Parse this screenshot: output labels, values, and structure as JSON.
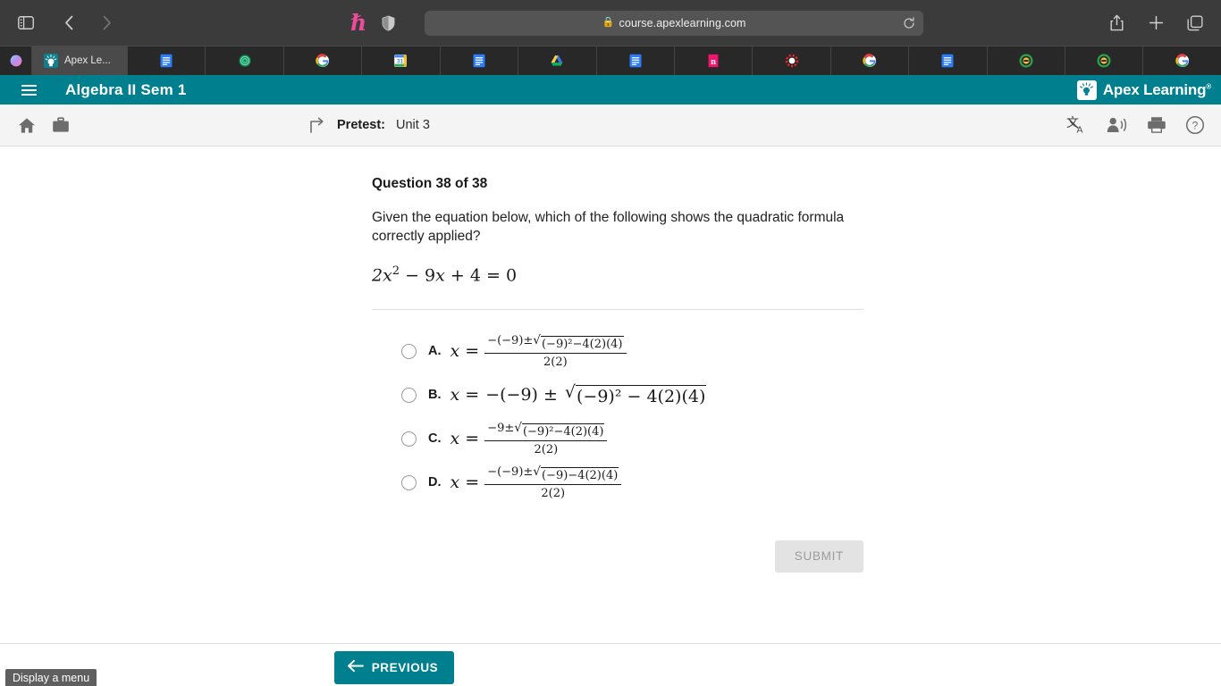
{
  "browser": {
    "url": "course.apexlearning.com",
    "lock_icon": "lock-icon",
    "sidebar_icon": "sidebar-toggle-icon",
    "back_icon": "back-chevron-icon",
    "forward_icon": "forward-chevron-icon",
    "honey_icon": "honey-extension-icon",
    "shield_icon": "shield-extension-icon",
    "reload_icon": "reload-icon",
    "share_icon": "share-icon",
    "newtab_icon": "plus-icon",
    "tabs_overview_icon": "tab-overview-icon",
    "active_tab_title": "Apex Le...",
    "tabs": [
      {
        "name": "tab-arc-browser",
        "favicon": "arc-icon",
        "title": ""
      },
      {
        "name": "tab-apex-learning",
        "favicon": "apex-icon",
        "title": "Apex Le..."
      },
      {
        "name": "tab-google-docs-1",
        "favicon": "docs-icon",
        "title": ""
      },
      {
        "name": "tab-green-globe",
        "favicon": "green-orb-icon",
        "title": ""
      },
      {
        "name": "tab-google-1",
        "favicon": "google-icon",
        "title": ""
      },
      {
        "name": "tab-google-calendar",
        "favicon": "calendar-31-icon",
        "title": ""
      },
      {
        "name": "tab-google-docs-2",
        "favicon": "docs-icon",
        "title": ""
      },
      {
        "name": "tab-google-drive",
        "favicon": "drive-icon",
        "title": ""
      },
      {
        "name": "tab-google-docs-3",
        "favicon": "docs-icon",
        "title": ""
      },
      {
        "name": "tab-notion",
        "favicon": "notion-n-icon",
        "title": ""
      },
      {
        "name": "tab-red-dotted",
        "favicon": "red-circle-icon",
        "title": ""
      },
      {
        "name": "tab-google-2",
        "favicon": "google-icon",
        "title": ""
      },
      {
        "name": "tab-google-docs-4",
        "favicon": "docs-icon",
        "title": ""
      },
      {
        "name": "tab-green-ring-1",
        "favicon": "green-ring-icon",
        "title": ""
      },
      {
        "name": "tab-green-ring-2",
        "favicon": "green-ring-icon",
        "title": ""
      },
      {
        "name": "tab-google-3",
        "favicon": "google-icon",
        "title": ""
      }
    ]
  },
  "app_header": {
    "menu_icon": "hamburger-menu-icon",
    "course_title": "Algebra II Sem 1",
    "brand_name": "Apex Learning",
    "brand_tm": "®",
    "brand_logo_icon": "apex-sun-logo-icon",
    "accent_color": "#00808f"
  },
  "subbar": {
    "home_icon": "home-icon",
    "briefcase_icon": "briefcase-icon",
    "up_level_icon": "up-level-arrow-icon",
    "breadcrumb_label": "Pretest:",
    "breadcrumb_value": "Unit 3",
    "translate_icon": "translate-icon",
    "read_aloud_icon": "read-aloud-icon",
    "print_icon": "print-icon",
    "help_icon": "help-icon"
  },
  "question": {
    "number_label": "Question 38 of 38",
    "prompt": "Given the equation below, which of the following shows the quadratic formula correctly applied?",
    "equation": {
      "coef_a": "2",
      "var": "x",
      "exp": "2",
      "minus": "−",
      "coef_b": "9",
      "plus": "+",
      "coef_c": "4",
      "equals": "=",
      "rhs": "0",
      "plain": "2x² − 9x + 4 = 0"
    },
    "options": [
      {
        "letter": "A.",
        "lead": "x =",
        "type": "fraction",
        "numerator_parts": {
          "prefix": "−(−9)±",
          "radicand": "(−9)²−4(2)(4)"
        },
        "denominator": "2(2)",
        "plain": "x = (−(−9)±√((−9)²−4(2)(4)))/(2(2))",
        "selected": false
      },
      {
        "letter": "B.",
        "lead": "x =",
        "type": "inline",
        "prefix": "−(−9) ±",
        "radicand": "(−9)² − 4(2)(4)",
        "plain": "x = −(−9) ± √((−9)² − 4(2)(4))",
        "selected": false
      },
      {
        "letter": "C.",
        "lead": "x =",
        "type": "fraction",
        "numerator_parts": {
          "prefix": "−9±",
          "radicand": "(−9)²−4(2)(4)"
        },
        "denominator": "2(2)",
        "plain": "x = (−9±√((−9)²−4(2)(4)))/(2(2))",
        "selected": false
      },
      {
        "letter": "D.",
        "lead": "x =",
        "type": "fraction",
        "numerator_parts": {
          "prefix": "−(−9)±",
          "radicand": "(−9)−4(2)(4)"
        },
        "denominator": "2(2)",
        "plain": "x = (−(−9)±√((−9)−4(2)(4)))/(2(2))",
        "selected": false
      }
    ],
    "submit_label": "SUBMIT",
    "submit_enabled": false
  },
  "bottom": {
    "previous_label": "PREVIOUS",
    "previous_arrow_icon": "arrow-left-icon",
    "tooltip": "Display a menu"
  }
}
